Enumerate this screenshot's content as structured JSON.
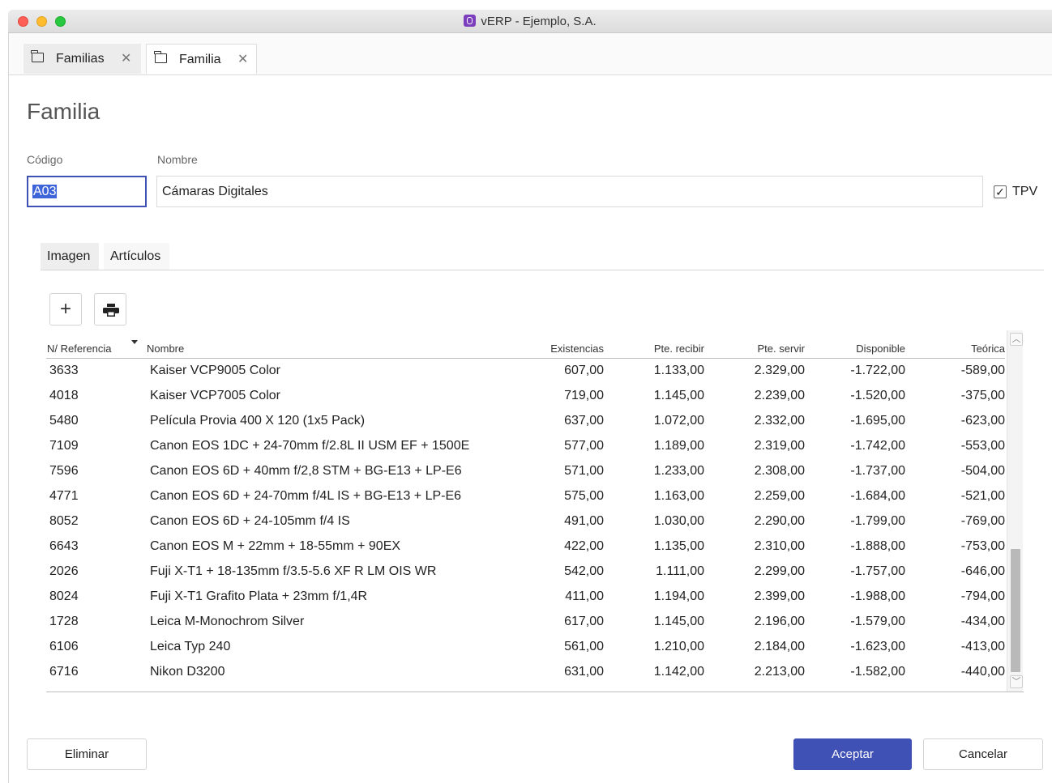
{
  "window": {
    "title": "vERP - Ejemplo, S.A."
  },
  "doc_tabs": [
    {
      "label": "Familias"
    },
    {
      "label": "Familia"
    }
  ],
  "page_title": "Familia",
  "form": {
    "codigo_label": "Código",
    "codigo_value": "A03",
    "nombre_label": "Nombre",
    "nombre_value": "Cámaras Digitales",
    "tpv_label": "TPV",
    "tpv_checked": true
  },
  "inner_tabs": [
    {
      "label": "Imagen"
    },
    {
      "label": "Artículos"
    }
  ],
  "toolbar": {
    "add_symbol": "+"
  },
  "table": {
    "columns": [
      "N/ Referencia",
      "Nombre",
      "Existencias",
      "Pte. recibir",
      "Pte. servir",
      "Disponible",
      "Teórica"
    ],
    "rows": [
      [
        "3633",
        "Kaiser VCP9005 Color",
        "607,00",
        "1.133,00",
        "2.329,00",
        "-1.722,00",
        "-589,00"
      ],
      [
        "4018",
        "Kaiser VCP7005 Color",
        "719,00",
        "1.145,00",
        "2.239,00",
        "-1.520,00",
        "-375,00"
      ],
      [
        "5480",
        "Película Provia 400 X 120 (1x5 Pack)",
        "637,00",
        "1.072,00",
        "2.332,00",
        "-1.695,00",
        "-623,00"
      ],
      [
        "7109",
        "Canon EOS 1DC + 24-70mm f/2.8L II USM EF + 1500E",
        "577,00",
        "1.189,00",
        "2.319,00",
        "-1.742,00",
        "-553,00"
      ],
      [
        "7596",
        "Canon EOS 6D + 40mm f/2,8 STM + BG-E13 + LP-E6",
        "571,00",
        "1.233,00",
        "2.308,00",
        "-1.737,00",
        "-504,00"
      ],
      [
        "4771",
        "Canon EOS 6D + 24-70mm f/4L IS + BG-E13 + LP-E6",
        "575,00",
        "1.163,00",
        "2.259,00",
        "-1.684,00",
        "-521,00"
      ],
      [
        "8052",
        "Canon EOS 6D + 24-105mm f/4 IS",
        "491,00",
        "1.030,00",
        "2.290,00",
        "-1.799,00",
        "-769,00"
      ],
      [
        "6643",
        "Canon EOS M + 22mm + 18-55mm + 90EX",
        "422,00",
        "1.135,00",
        "2.310,00",
        "-1.888,00",
        "-753,00"
      ],
      [
        "2026",
        "Fuji X-T1 + 18-135mm f/3.5-5.6 XF R LM OIS WR",
        "542,00",
        "1.111,00",
        "2.299,00",
        "-1.757,00",
        "-646,00"
      ],
      [
        "8024",
        "Fuji X-T1 Grafito Plata + 23mm f/1,4R",
        "411,00",
        "1.194,00",
        "2.399,00",
        "-1.988,00",
        "-794,00"
      ],
      [
        "1728",
        "Leica M-Monochrom Silver",
        "617,00",
        "1.145,00",
        "2.196,00",
        "-1.579,00",
        "-434,00"
      ],
      [
        "6106",
        "Leica Typ 240",
        "561,00",
        "1.210,00",
        "2.184,00",
        "-1.623,00",
        "-413,00"
      ],
      [
        "6716",
        "Nikon D3200",
        "631,00",
        "1.142,00",
        "2.213,00",
        "-1.582,00",
        "-440,00"
      ]
    ]
  },
  "buttons": {
    "eliminar": "Eliminar",
    "aceptar": "Aceptar",
    "cancelar": "Cancelar"
  },
  "colors": {
    "accent": "#3f51b5",
    "selection": "#3d64d9",
    "app_icon": "#7b3fbe"
  },
  "icons": {
    "tab_icon": "folder-icon",
    "add": "plus-icon",
    "print": "printer-icon",
    "sort": "sort-desc-icon"
  }
}
